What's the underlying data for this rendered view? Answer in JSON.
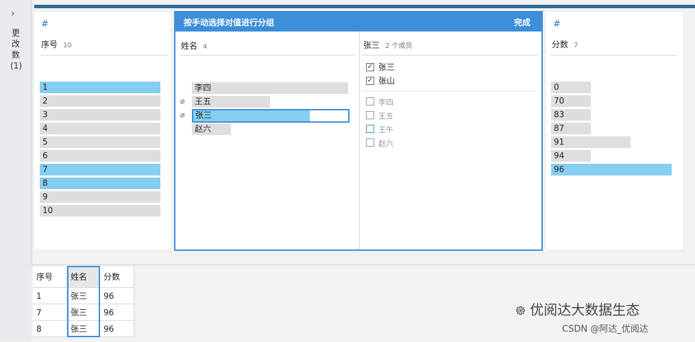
{
  "rail": {
    "label": "更改数 (1)",
    "chevron_icon": "chevron-right-icon"
  },
  "columns": {
    "seq": {
      "icon": "#",
      "name": "序号",
      "count": "10",
      "values": [
        "1",
        "2",
        "3",
        "4",
        "5",
        "6",
        "7",
        "8",
        "9",
        "10"
      ],
      "selected": [
        true,
        false,
        false,
        false,
        false,
        false,
        true,
        true,
        false,
        false
      ]
    },
    "name": {
      "name": "姓名",
      "count": "4",
      "values": [
        "李四",
        "王五",
        "张三",
        "赵六"
      ],
      "bar_fraction": [
        1.0,
        0.5,
        0.75,
        0.25
      ],
      "clip": [
        false,
        true,
        true,
        false
      ]
    },
    "score": {
      "icon": "#",
      "name": "分数",
      "count": "7",
      "values": [
        "0",
        "70",
        "83",
        "87",
        "91",
        "94",
        "96"
      ],
      "bar_fraction": [
        0.33,
        0.33,
        0.33,
        0.33,
        0.66,
        0.33,
        1.0
      ],
      "selected": [
        false,
        false,
        false,
        false,
        false,
        false,
        true
      ]
    }
  },
  "modal": {
    "title": "按手动选择对值进行分组",
    "done": "完成",
    "group": {
      "name": "张三",
      "members": "2 个成员"
    },
    "checked": [
      "张三",
      "张山"
    ],
    "unchecked": [
      "李四",
      "王五",
      "王午",
      "赵六"
    ]
  },
  "grid": {
    "headers": [
      "序号",
      "姓名",
      "分数"
    ],
    "rows": [
      [
        "1",
        "张三",
        "96"
      ],
      [
        "7",
        "张三",
        "96"
      ],
      [
        "8",
        "张三",
        "96"
      ]
    ]
  },
  "watermark": {
    "line1": "优阅达大数据生态",
    "line2": "CSDN @阿达_优阅达"
  },
  "colors": {
    "accent": "#3d8fd9",
    "selected_bar": "#86cdf2",
    "bar": "#dedede",
    "top_bar": "#2e6c93"
  }
}
